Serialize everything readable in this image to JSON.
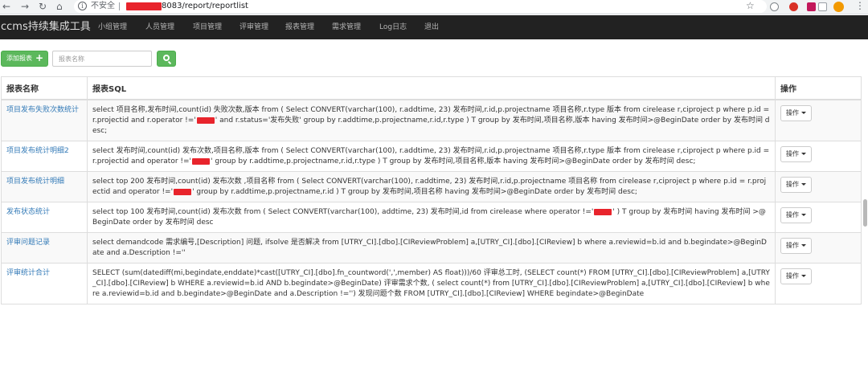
{
  "browser": {
    "insecure_label": "不安全",
    "url_suffix": "8083/report/reportlist"
  },
  "navbar": {
    "brand": "ccms持续集成工具",
    "items": [
      {
        "label": "小组管理"
      },
      {
        "label": "人员管理"
      },
      {
        "label": "项目管理"
      },
      {
        "label": "评审管理"
      },
      {
        "label": "报表管理"
      },
      {
        "label": "需求管理"
      },
      {
        "label": "Log日志"
      },
      {
        "label": "退出"
      }
    ]
  },
  "toolbar": {
    "add_label": "添加报表",
    "search_placeholder": "报表名称"
  },
  "table": {
    "headers": [
      "报表名称",
      "报表SQL",
      "操作"
    ],
    "ops_label": "操作",
    "rows": [
      {
        "name": "项目发布失败次数统计",
        "sql_a": "select 项目名称,发布时间,count(id) 失败次数,版本 from ( Select CONVERT(varchar(100), r.addtime, 23) 发布时间,r.id,p.projectname 项目名称,r.type 版本 from cirelease r,ciproject p where p.id = r.projectid and r.operator !='",
        "sql_b": "' and r.status='发布失败' group by r.addtime,p.projectname,r.id,r.type ) T group by 发布时间,项目名称,版本 having 发布时间>@BeginDate order by 发布时间 desc;"
      },
      {
        "name": "项目发布统计明细2",
        "sql_a": "select 发布时间,count(id) 发布次数,项目名称,版本 from ( Select CONVERT(varchar(100), r.addtime, 23) 发布时间,r.id,p.projectname 项目名称,r.type 版本 from cirelease r,ciproject p where p.id = r.projectid and operator !='",
        "sql_b": "' group by r.addtime,p.projectname,r.id,r.type ) T group by 发布时间,项目名称,版本 having 发布时间>@BeginDate order by 发布时间 desc;"
      },
      {
        "name": "项目发布统计明细",
        "sql_a": "select top 200 发布时间,count(id) 发布次数 ,项目名称 from ( Select CONVERT(varchar(100), r.addtime, 23) 发布时间,r.id,p.projectname 项目名称 from cirelease r,ciproject p where p.id = r.projectid and operator !='",
        "sql_b": "' group by r.addtime,p.projectname,r.id ) T group by 发布时间,项目名称 having 发布时间>@BeginDate order by 发布时间 desc;"
      },
      {
        "name": "发布状态统计",
        "sql_a": "select top 100 发布时间,count(id) 发布次数 from ( Select CONVERT(varchar(100), addtime, 23) 发布时间,id from cirelease where operator !='",
        "sql_b": "' ) T group by 发布时间 having 发布时间 >@BeginDate order by 发布时间 desc"
      },
      {
        "name": "评审问题记录",
        "sql_a": "select demandcode 需求编号,[Description] 问题, ifsolve 是否解决 from [UTRY_CI].[dbo].[CIReviewProblem] a,[UTRY_CI].[dbo].[CIReview] b where a.reviewid=b.id and b.begindate>@BeginDate and a.Description !=''",
        "sql_b": ""
      },
      {
        "name": "评审统计合计",
        "sql_a": "SELECT (sum(datediff(mi,begindate,enddate)*cast([UTRY_CI].[dbo].fn_countword(',',member) AS float)))/60 评审总工时, (SELECT count(*) FROM [UTRY_CI].[dbo].[CIReviewProblem] a,[UTRY_CI].[dbo].[CIReview] b WHERE a.reviewid=b.id AND b.begindate>@BeginDate) 评审需求个数, ( select count(*) from [UTRY_CI].[dbo].[CIReviewProblem] a,[UTRY_CI].[dbo].[CIReview] b where a.reviewid=b.id and b.begindate>@BeginDate and a.Description !='') 发现问题个数 FROM [UTRY_CI].[dbo].[CIReview] WHERE begindate>@BeginDate",
        "sql_b": ""
      }
    ]
  }
}
